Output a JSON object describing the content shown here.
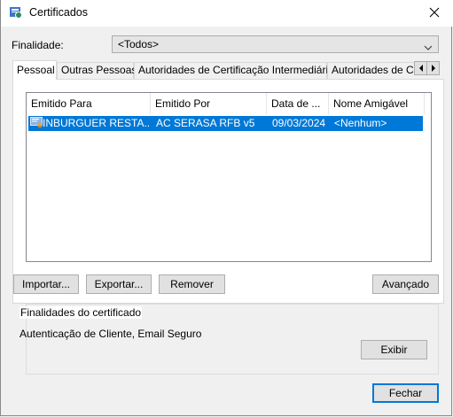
{
  "window": {
    "title": "Certificados"
  },
  "purpose": {
    "label": "Finalidade:",
    "value": "<Todos>"
  },
  "tabs": [
    {
      "label": "Pessoal"
    },
    {
      "label": "Outras Pessoas"
    },
    {
      "label": "Autoridades de Certificação Intermediárias"
    },
    {
      "label": "Autoridades de Ce"
    }
  ],
  "table": {
    "columns": [
      "Emitido Para",
      "Emitido Por",
      "Data de ...",
      "Nome Amigável"
    ],
    "rows": [
      {
        "issued_to": "INBURGUER RESTA...",
        "issued_by": "AC SERASA RFB v5",
        "expiration": "09/03/2024",
        "friendly_name": "<Nenhum>"
      }
    ]
  },
  "buttons": {
    "import": "Importar...",
    "export": "Exportar...",
    "remove": "Remover",
    "advanced": "Avançado",
    "view": "Exibir",
    "close": "Fechar"
  },
  "purposes_group": {
    "title": "Finalidades do certificado",
    "text": "Autenticação de Cliente, Email Seguro"
  },
  "colors": {
    "selection": "#0078d7",
    "default_button_border": "#0078d7"
  }
}
